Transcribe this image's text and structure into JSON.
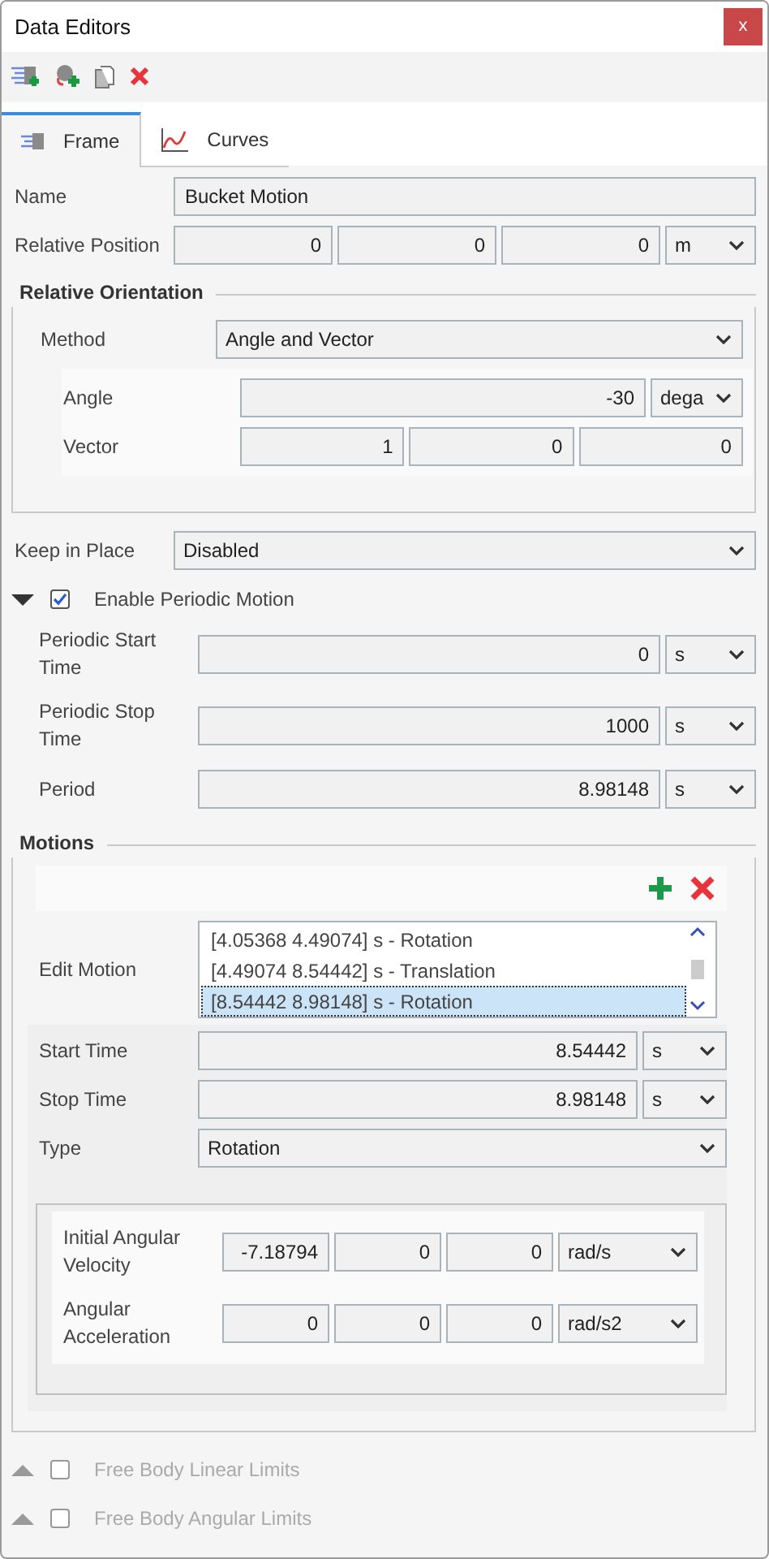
{
  "window": {
    "title": "Data Editors",
    "close": "x"
  },
  "tabs": [
    {
      "label": "Frame",
      "selected": true
    },
    {
      "label": "Curves",
      "selected": false
    }
  ],
  "fields": [
    {
      "kind": "text",
      "label": "Name",
      "value": "Bucket Motion"
    },
    {
      "kind": "numbers",
      "label": "Relative Position",
      "values": [
        "0",
        "0",
        "0"
      ],
      "unit": "m"
    }
  ],
  "relative_orientation": {
    "title": "Relative Orientation",
    "method": {
      "kind": "select",
      "label": "Method",
      "value": "Angle and Vector"
    },
    "rows": [
      {
        "kind": "numbers",
        "label": "Angle",
        "values": [
          "-30"
        ],
        "unit": "dega"
      },
      {
        "kind": "numbers",
        "label": "Vector",
        "values": [
          "1",
          "0",
          "0"
        ]
      }
    ]
  },
  "keep_in_place": {
    "kind": "select",
    "label": "Keep in Place",
    "value": "Disabled"
  },
  "periodic": {
    "label": "Enable Periodic Motion",
    "expanded": true,
    "checked": true,
    "disabled": false,
    "rows": [
      {
        "kind": "numbers",
        "label": "Periodic Start Time",
        "values": [
          "0"
        ],
        "unit": "s"
      },
      {
        "kind": "numbers",
        "label": "Periodic Stop Time",
        "values": [
          "1000"
        ],
        "unit": "s"
      },
      {
        "kind": "numbers",
        "label": "Period",
        "values": [
          "8.98148"
        ],
        "unit": "s"
      }
    ]
  },
  "motions": {
    "title": "Motions",
    "edit_motion": {
      "label": "Edit Motion",
      "items": [
        {
          "text": "[4.05368 4.49074] s - Rotation",
          "selected": false
        },
        {
          "text": "[4.49074 8.54442] s - Translation",
          "selected": false
        },
        {
          "text": "[8.54442 8.98148] s - Rotation",
          "selected": true
        }
      ]
    },
    "rows": [
      {
        "kind": "numbers",
        "label": "Start Time",
        "values": [
          "8.54442"
        ],
        "unit": "s"
      },
      {
        "kind": "numbers",
        "label": "Stop Time",
        "values": [
          "8.98148"
        ],
        "unit": "s"
      },
      {
        "kind": "select",
        "label": "Type",
        "value": "Rotation"
      }
    ],
    "rotation": [
      {
        "kind": "numbers",
        "label": "Initial Angular Velocity",
        "values": [
          "-7.18794",
          "0",
          "0"
        ],
        "unit": "rad/s"
      },
      {
        "kind": "numbers",
        "label": "Angular Acceleration",
        "values": [
          "0",
          "0",
          "0"
        ],
        "unit": "rad/s2"
      }
    ]
  },
  "limits": [
    {
      "label": "Free Body Linear Limits",
      "expanded": false,
      "checked": false,
      "disabled": true
    },
    {
      "label": "Free Body Angular Limits",
      "expanded": false,
      "checked": false,
      "disabled": true
    }
  ]
}
